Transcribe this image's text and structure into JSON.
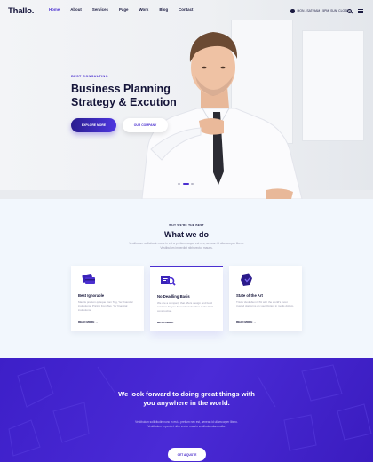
{
  "header": {
    "logo": "Thallo.",
    "nav": [
      {
        "label": "Home",
        "active": true
      },
      {
        "label": "About",
        "active": false
      },
      {
        "label": "Services",
        "active": false
      },
      {
        "label": "Page",
        "active": false
      },
      {
        "label": "Work",
        "active": false
      },
      {
        "label": "Blog",
        "active": false
      },
      {
        "label": "Contact",
        "active": false
      }
    ],
    "hours": "MON - SAT: 9AM - 5PM, SUN: CLOSED"
  },
  "hero": {
    "eyebrow": "BEST CONSULTING",
    "title": "Business Planning Strategy & Excution",
    "primary_button": "EXPLORE MORE",
    "secondary_button": "OUR COMPANY",
    "slide_count": 3,
    "active_slide": 2
  },
  "services": {
    "eyebrow": "WHY WE'RE THE BEST",
    "title": "What we do",
    "description": "Vestibulum sollicitudin nunc in est a pretium neque est nec, aenean id ullamcorper libero. Vestibulum imperdiet nibh vector mauris.",
    "cards": [
      {
        "title": "Best Ignorable",
        "text": "Mauris pretium quisque from Tag, Yer financial institutions. Pricing from Tag, Yer financial institutions.",
        "link": "READ MORE",
        "icon": "credit-card-icon",
        "featured": false
      },
      {
        "title": "No Deadling Basis",
        "text": "We are a company that offers design and build services for you from initial sketches to the final construction.",
        "link": "READ MORE",
        "icon": "magnifier-report-icon",
        "featured": true
      },
      {
        "title": "State of the Art",
        "text": "Tristis Vestiubum ETA with the world's most trusted platforms on your Option in mollis dictum.",
        "link": "READ MORE",
        "icon": "shield-check-icon",
        "featured": false
      }
    ]
  },
  "cta": {
    "title": "We look forward to doing great things with you anywhere in the world.",
    "description": "Vestibulum sollicitudin nunc in est a pretium nec est, aenean id ullamcorper libero. Vestibulum imperdiet nibh vector mauris vestibulumdare nulla.",
    "button": "GET A QUOTE"
  },
  "colors": {
    "accent": "#4a2fd0",
    "dark": "#141438",
    "section_bg": "#f2f7fd",
    "cta_bg": "#3d1fc8"
  }
}
